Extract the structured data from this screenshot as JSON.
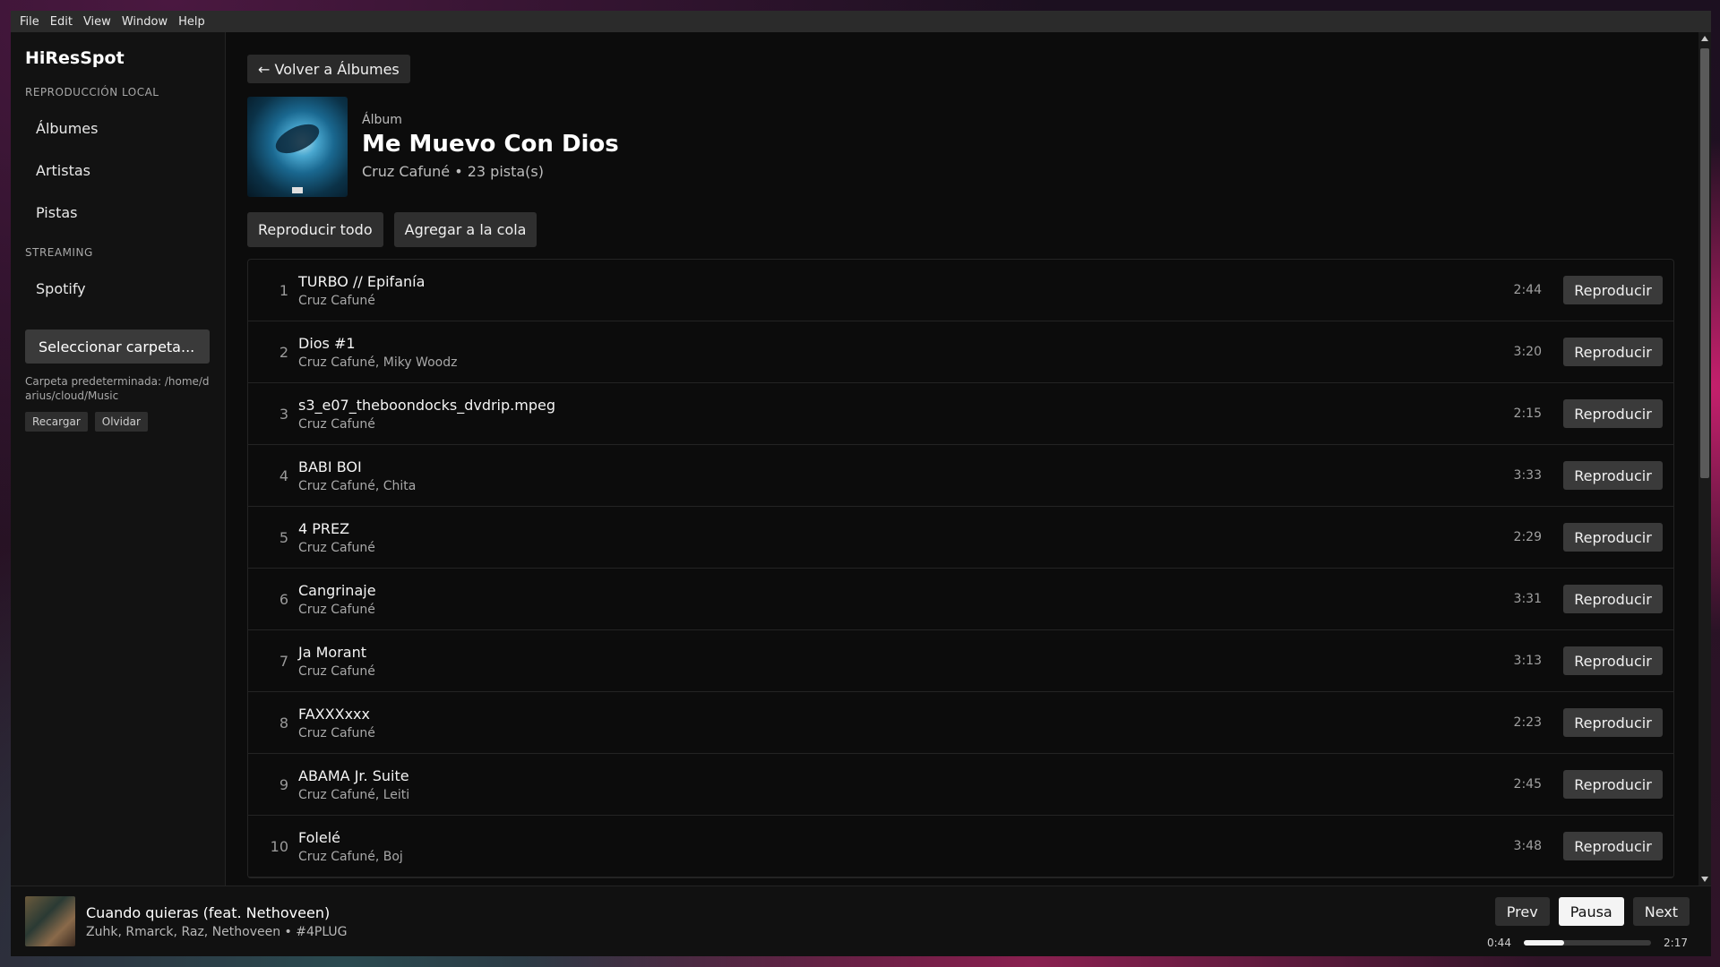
{
  "menu": [
    "File",
    "Edit",
    "View",
    "Window",
    "Help"
  ],
  "sidebar": {
    "brand": "HiResSpot",
    "local_label": "REPRODUCCIÓN LOCAL",
    "local_items": [
      "Álbumes",
      "Artistas",
      "Pistas"
    ],
    "streaming_label": "STREAMING",
    "streaming_items": [
      "Spotify"
    ],
    "select_folder": "Seleccionar carpeta...",
    "default_folder": "Carpeta predeterminada: /home/darius/cloud/Music",
    "reload": "Recargar",
    "forget": "Olvidar"
  },
  "album": {
    "back": "← Volver a Álbumes",
    "type": "Álbum",
    "title": "Me Muevo Con Dios",
    "meta": "Cruz Cafuné • 23 pista(s)",
    "play_all": "Reproducir todo",
    "add_queue": "Agregar a la cola",
    "play_label": "Reproducir",
    "tracks": [
      {
        "num": "1",
        "title": "TURBO // Epifanía",
        "artist": "Cruz Cafuné",
        "duration": "2:44"
      },
      {
        "num": "2",
        "title": "Dios #1",
        "artist": "Cruz Cafuné, Miky Woodz",
        "duration": "3:20"
      },
      {
        "num": "3",
        "title": "s3_e07_theboondocks_dvdrip.mpeg",
        "artist": "Cruz Cafuné",
        "duration": "2:15"
      },
      {
        "num": "4",
        "title": "BABI BOI",
        "artist": "Cruz Cafuné, Chita",
        "duration": "3:33"
      },
      {
        "num": "5",
        "title": "4 PREZ",
        "artist": "Cruz Cafuné",
        "duration": "2:29"
      },
      {
        "num": "6",
        "title": "Cangrinaje",
        "artist": "Cruz Cafuné",
        "duration": "3:31"
      },
      {
        "num": "7",
        "title": "Ja Morant",
        "artist": "Cruz Cafuné",
        "duration": "3:13"
      },
      {
        "num": "8",
        "title": "FAXXXxxx",
        "artist": "Cruz Cafuné",
        "duration": "2:23"
      },
      {
        "num": "9",
        "title": "ABAMA Jr. Suite",
        "artist": "Cruz Cafuné, Leiti",
        "duration": "2:45"
      },
      {
        "num": "10",
        "title": "Folelé",
        "artist": "Cruz Cafuné, Boj",
        "duration": "3:48"
      }
    ]
  },
  "player": {
    "title": "Cuando quieras (feat. Nethoveen)",
    "artist": "Zuhk, Rmarck, Raz, Nethoveen • #4PLUG",
    "prev": "Prev",
    "pause": "Pausa",
    "next": "Next",
    "elapsed": "0:44",
    "total": "2:17",
    "progress_fraction": 0.32
  }
}
